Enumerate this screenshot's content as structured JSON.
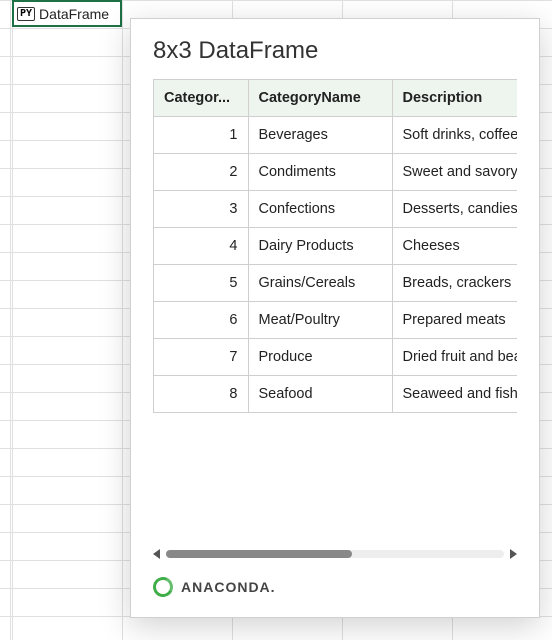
{
  "cell": {
    "badge": "PY",
    "text": "DataFrame"
  },
  "card": {
    "title": "8x3 DataFrame",
    "columns": [
      "Categor...",
      "CategoryName",
      "Description"
    ],
    "rows": [
      {
        "idx": "1",
        "name": "Beverages",
        "desc": "Soft drinks, coffees, teas"
      },
      {
        "idx": "2",
        "name": "Condiments",
        "desc": "Sweet and savory sauces"
      },
      {
        "idx": "3",
        "name": "Confections",
        "desc": "Desserts, candies"
      },
      {
        "idx": "4",
        "name": "Dairy Products",
        "desc": "Cheeses"
      },
      {
        "idx": "5",
        "name": "Grains/Cereals",
        "desc": "Breads, crackers"
      },
      {
        "idx": "6",
        "name": "Meat/Poultry",
        "desc": "Prepared meats"
      },
      {
        "idx": "7",
        "name": "Produce",
        "desc": "Dried fruit and bean curd"
      },
      {
        "idx": "8",
        "name": "Seafood",
        "desc": "Seaweed and fish"
      }
    ]
  },
  "footer": {
    "brand": "ANACONDA."
  },
  "chart_data": {
    "type": "table",
    "title": "8x3 DataFrame",
    "columns": [
      "CategoryID",
      "CategoryName",
      "Description"
    ],
    "rows": [
      [
        1,
        "Beverages",
        "Soft drinks, coffees, teas"
      ],
      [
        2,
        "Condiments",
        "Sweet and savory sauces"
      ],
      [
        3,
        "Confections",
        "Desserts, candies"
      ],
      [
        4,
        "Dairy Products",
        "Cheeses"
      ],
      [
        5,
        "Grains/Cereals",
        "Breads, crackers"
      ],
      [
        6,
        "Meat/Poultry",
        "Prepared meats"
      ],
      [
        7,
        "Produce",
        "Dried fruit and bean curd"
      ],
      [
        8,
        "Seafood",
        "Seaweed and fish"
      ]
    ]
  }
}
